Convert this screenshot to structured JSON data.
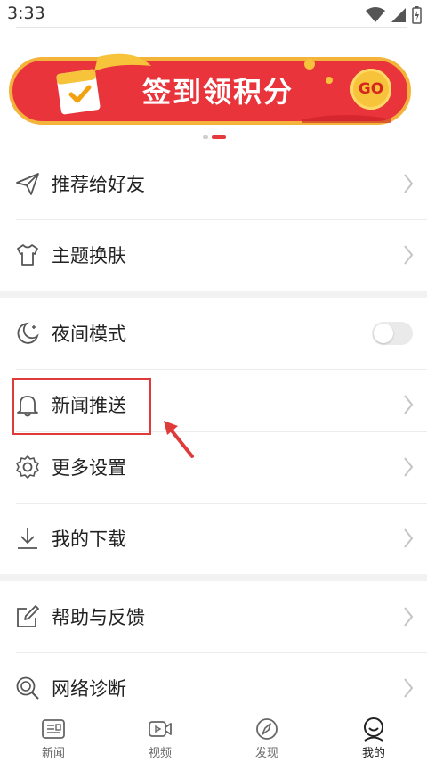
{
  "status": {
    "time": "3:33"
  },
  "banner": {
    "title": "签到领积分",
    "go": "GO"
  },
  "menu": {
    "recommend": "推荐给好友",
    "theme": "主题换肤",
    "night": "夜间模式",
    "push": "新闻推送",
    "more_settings": "更多设置",
    "downloads": "我的下载",
    "help": "帮助与反馈",
    "network": "网络诊断"
  },
  "tabs": {
    "news": "新闻",
    "video": "视频",
    "discover": "发现",
    "mine": "我的"
  },
  "colors": {
    "accent": "#e33b3b",
    "banner_red": "#e8343a",
    "gold": "#f6c33b"
  }
}
